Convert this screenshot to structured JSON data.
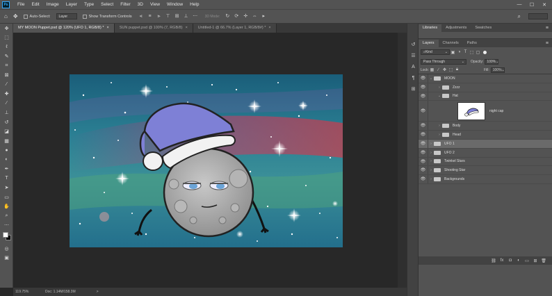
{
  "app": {
    "logo": "Ps",
    "menu": [
      "File",
      "Edit",
      "Image",
      "Layer",
      "Type",
      "Select",
      "Filter",
      "3D",
      "View",
      "Window",
      "Help"
    ],
    "window_controls": {
      "minimize": "—",
      "maximize": "☐",
      "close": "✕"
    }
  },
  "options": {
    "auto_select_label": "Auto-Select:",
    "auto_select_value": "Layer",
    "transform_label": "Show Transform Controls",
    "mode_3d": "3D Mode:"
  },
  "tabs": [
    {
      "label": "MY MOON Puppet.psd @ 120% (UFO 1, RGB/8) *",
      "close": "×"
    },
    {
      "label": "SUN puppet.psd @ 100% (7, RGB/8)",
      "close": "×"
    },
    {
      "label": "Untitled-1 @ 66.7% (Layer 1, RGB/8#) *",
      "close": "×"
    }
  ],
  "status": {
    "zoom": "119.75%",
    "doc": "Doc: 1.14M/158.3M",
    "arrow": ">"
  },
  "panels": {
    "top_tabs": [
      "Libraries",
      "Adjustments",
      "Swatches"
    ],
    "layer_tabs": [
      "Layers",
      "Channels",
      "Paths"
    ],
    "kind_label": "Kind",
    "blend_mode": "Pass Through",
    "opacity_label": "Opacity:",
    "opacity_value": "100%",
    "lock_label": "Lock:",
    "fill_label": "Fill:",
    "fill_value": "100%"
  },
  "layers": [
    {
      "name": "MOON",
      "indent": 0,
      "expanded": true
    },
    {
      "name": "Zzzz",
      "indent": 1,
      "expanded": false
    },
    {
      "name": "Hat",
      "indent": 1,
      "expanded": true
    },
    {
      "name": "night cap",
      "indent": 2,
      "thumbnail": true
    },
    {
      "name": "Body",
      "indent": 1,
      "expanded": false
    },
    {
      "name": "Head",
      "indent": 1,
      "expanded": false
    },
    {
      "name": "UFO 1",
      "indent": 0,
      "expanded": false,
      "selected": true
    },
    {
      "name": "UFO 2",
      "indent": 0,
      "expanded": false
    },
    {
      "name": "Twinkel Stars",
      "indent": 0,
      "expanded": false
    },
    {
      "name": "Shooting Star",
      "indent": 0,
      "expanded": false
    },
    {
      "name": "Backgrounds",
      "indent": 0,
      "expanded": false
    }
  ],
  "colors": {
    "accent": "#31a8ff",
    "hat": "#7e80d6",
    "moon": "#a9a9a9",
    "panel": "#535353",
    "canvas_bg": "#282828"
  }
}
